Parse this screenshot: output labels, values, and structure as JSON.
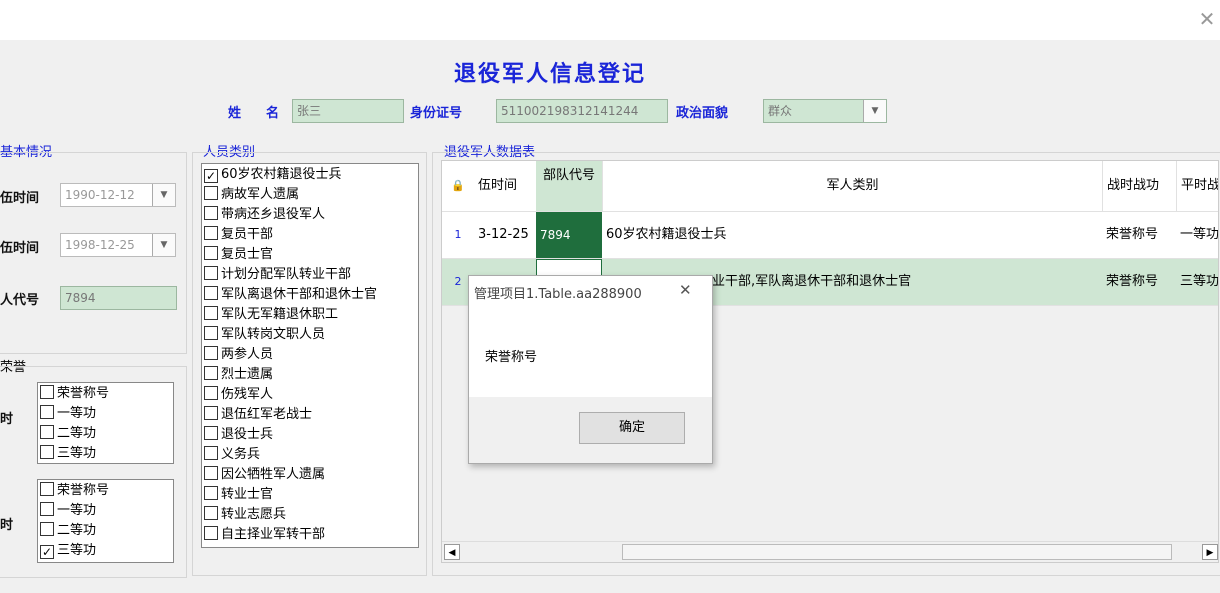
{
  "window": {
    "close_label": "✕"
  },
  "title": "退役军人信息登记",
  "header": {
    "name_label": "姓　名",
    "name_value": "张三",
    "id_label": "身份证号",
    "id_value": "511002198312141244",
    "political_label": "政治面貌",
    "political_value": "群众"
  },
  "basic": {
    "group_title": "基本情况",
    "enlist_label": "伍时间",
    "enlist_value": "1990-12-12",
    "discharge_label": "伍时间",
    "discharge_value": "1998-12-25",
    "unit_label": "人代号",
    "unit_value": "7894"
  },
  "honor": {
    "group_title": "荣誉",
    "war_label": "时",
    "peace_label": "时",
    "war_items": [
      {
        "label": "荣誉称号",
        "checked": false
      },
      {
        "label": "一等功",
        "checked": false
      },
      {
        "label": "二等功",
        "checked": false
      },
      {
        "label": "三等功",
        "checked": false
      }
    ],
    "peace_items": [
      {
        "label": "荣誉称号",
        "checked": false
      },
      {
        "label": "一等功",
        "checked": false
      },
      {
        "label": "二等功",
        "checked": false
      },
      {
        "label": "三等功",
        "checked": true
      }
    ]
  },
  "category": {
    "group_title": "人员类别",
    "items": [
      {
        "label": "60岁农村籍退役士兵",
        "checked": true
      },
      {
        "label": "病故军人遗属",
        "checked": false
      },
      {
        "label": "带病还乡退役军人",
        "checked": false
      },
      {
        "label": "复员干部",
        "checked": false
      },
      {
        "label": "复员士官",
        "checked": false
      },
      {
        "label": "计划分配军队转业干部",
        "checked": false
      },
      {
        "label": "军队离退休干部和退休士官",
        "checked": false
      },
      {
        "label": "军队无军籍退休职工",
        "checked": false
      },
      {
        "label": "军队转岗文职人员",
        "checked": false
      },
      {
        "label": "两参人员",
        "checked": false
      },
      {
        "label": "烈士遗属",
        "checked": false
      },
      {
        "label": "伤残军人",
        "checked": false
      },
      {
        "label": "退伍红军老战士",
        "checked": false
      },
      {
        "label": "退役士兵",
        "checked": false
      },
      {
        "label": "义务兵",
        "checked": false
      },
      {
        "label": "因公牺牲军人遗属",
        "checked": false
      },
      {
        "label": "转业士官",
        "checked": false
      },
      {
        "label": "转业志愿兵",
        "checked": false
      },
      {
        "label": "自主择业军转干部",
        "checked": false
      }
    ]
  },
  "table": {
    "group_title": "退役军人数据表",
    "lock_icon": "🔒",
    "columns": [
      "伍时间",
      "部队代号",
      "军人类别",
      "战时战功",
      "平时战"
    ],
    "rows": [
      {
        "num": "1",
        "date": "3-12-25",
        "code": "7894",
        "category": "60岁农村籍退役士兵",
        "war": "荣誉称号",
        "peace": "一等功"
      },
      {
        "num": "2",
        "date": "",
        "code": "",
        "category": "业干部,军队离退休干部和退休士官",
        "war": "荣誉称号",
        "peace": "三等功"
      }
    ]
  },
  "dialog": {
    "title": "管理项目1.Table.aa288900",
    "close_label": "✕",
    "message": "荣誉称号",
    "ok_label": "确定"
  }
}
